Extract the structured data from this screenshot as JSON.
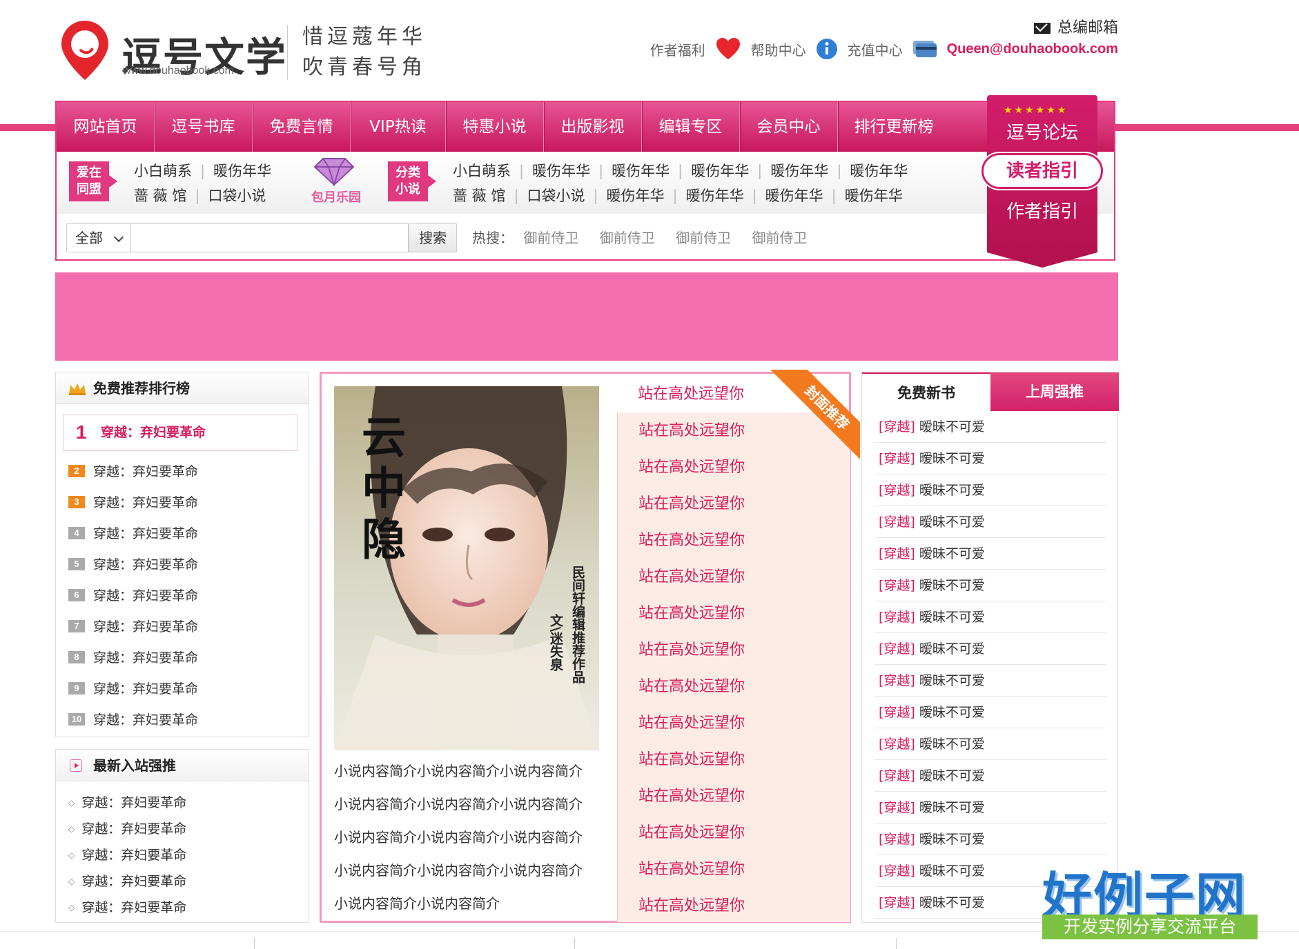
{
  "header": {
    "site_name": "逗号文学",
    "domain": "www.douhaobook.com",
    "slogan_line1": "惜逗蔻年华",
    "slogan_line2": "吹青春号角",
    "mail_label": "总编邮箱",
    "links": [
      "作者福利",
      "帮助中心",
      "充值中心"
    ],
    "email": "Queen@douhaobook.com"
  },
  "nav": {
    "items": [
      "网站首页",
      "逗号书库",
      "免费言情",
      "VIP热读",
      "特惠小说",
      "出版影视",
      "编辑专区",
      "会员中心",
      "排行更新榜"
    ]
  },
  "ribbon": {
    "stars": "★★★★★★",
    "forum": "逗号论坛",
    "reader": "读者指引",
    "writer": "作者指引"
  },
  "subnav": {
    "tag1": [
      "爱在",
      "同盟"
    ],
    "group1_row1": [
      "小白萌系",
      "暖伤年华"
    ],
    "group1_row2": [
      "蔷 薇 馆",
      "口袋小说"
    ],
    "gem_label": "包月乐园",
    "tag2": [
      "分类",
      "小说"
    ],
    "group2_row1": [
      "小白萌系",
      "暖伤年华",
      "暖伤年华",
      "暖伤年华",
      "暖伤年华",
      "暖伤年华"
    ],
    "group2_row2": [
      "蔷 薇 馆",
      "口袋小说",
      "暖伤年华",
      "暖伤年华",
      "暖伤年华",
      "暖伤年华"
    ]
  },
  "search": {
    "category": "全部",
    "value": "",
    "button": "搜索",
    "hot_label": "热搜：",
    "hot": [
      "御前侍卫",
      "御前侍卫",
      "御前侍卫",
      "御前侍卫"
    ]
  },
  "rank_panel": {
    "title": "免费推荐排行榜",
    "top": {
      "num": "1",
      "text": "穿越：弃妇要革命"
    },
    "items": [
      {
        "num": "2",
        "text": "穿越：弃妇要革命"
      },
      {
        "num": "3",
        "text": "穿越：弃妇要革命"
      },
      {
        "num": "4",
        "text": "穿越：弃妇要革命"
      },
      {
        "num": "5",
        "text": "穿越：弃妇要革命"
      },
      {
        "num": "6",
        "text": "穿越：弃妇要革命"
      },
      {
        "num": "7",
        "text": "穿越：弃妇要革命"
      },
      {
        "num": "8",
        "text": "穿越：弃妇要革命"
      },
      {
        "num": "9",
        "text": "穿越：弃妇要革命"
      },
      {
        "num": "10",
        "text": "穿越：弃妇要革命"
      }
    ]
  },
  "new_panel": {
    "title": "最新入站强推",
    "items": [
      "穿越：弃妇要革命",
      "穿越：弃妇要革命",
      "穿越：弃妇要革命",
      "穿越：弃妇要革命",
      "穿越：弃妇要革命"
    ]
  },
  "center": {
    "corner_label": "封面推荐",
    "cover_title": "云中隐",
    "cover_side1": "民间轩编辑推荐作品",
    "cover_side2": "文\\迷失泉",
    "desc": [
      "小说内容简介小说内容简介小说内容简介",
      "小说内容简介小说内容简介小说内容简介",
      "小说内容简介小说内容简介小说内容简介",
      "小说内容简介小说内容简介小说内容简介",
      "小说内容简介小说内容简介"
    ],
    "first_link": "站在高处远望你",
    "links": [
      "站在高处远望你",
      "站在高处远望你",
      "站在高处远望你",
      "站在高处远望你",
      "站在高处远望你",
      "站在高处远望你",
      "站在高处远望你",
      "站在高处远望你",
      "站在高处远望你",
      "站在高处远望你",
      "站在高处远望你",
      "站在高处远望你",
      "站在高处远望你",
      "站在高处远望你"
    ]
  },
  "right_panel": {
    "tab_active": "免费新书",
    "tab_other": "上周强推",
    "items": [
      {
        "cat": "[穿越]",
        "title": "暧昧不可爱"
      },
      {
        "cat": "[穿越]",
        "title": "暧昧不可爱"
      },
      {
        "cat": "[穿越]",
        "title": "暧昧不可爱"
      },
      {
        "cat": "[穿越]",
        "title": "暧昧不可爱"
      },
      {
        "cat": "[穿越]",
        "title": "暧昧不可爱"
      },
      {
        "cat": "[穿越]",
        "title": "暧昧不可爱"
      },
      {
        "cat": "[穿越]",
        "title": "暧昧不可爱"
      },
      {
        "cat": "[穿越]",
        "title": "暧昧不可爱"
      },
      {
        "cat": "[穿越]",
        "title": "暧昧不可爱"
      },
      {
        "cat": "[穿越]",
        "title": "暧昧不可爱"
      },
      {
        "cat": "[穿越]",
        "title": "暧昧不可爱"
      },
      {
        "cat": "[穿越]",
        "title": "暧昧不可爱"
      },
      {
        "cat": "[穿越]",
        "title": "暧昧不可爱"
      },
      {
        "cat": "[穿越]",
        "title": "暧昧不可爱"
      },
      {
        "cat": "[穿越]",
        "title": "暧昧不可爱"
      },
      {
        "cat": "[穿越]",
        "title": "暧昧不可爱"
      }
    ]
  },
  "watermark": {
    "title": "好例子网",
    "subtitle": "开发实例分享交流平台"
  },
  "colors": {
    "brand": "#d81e5b",
    "nav": "#d0206a",
    "banner": "#f26eaf",
    "accent_orange": "#f47a20"
  }
}
